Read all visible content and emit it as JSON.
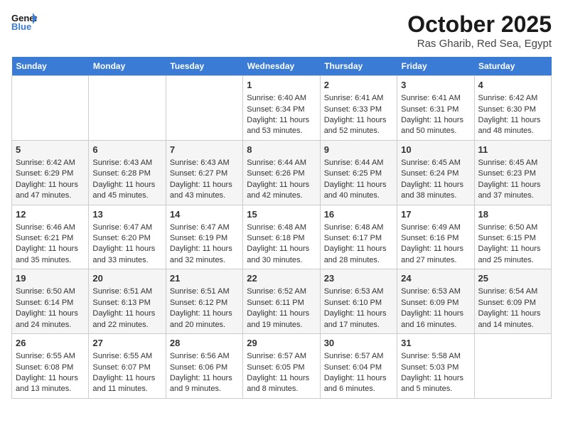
{
  "header": {
    "logo_text_general": "General",
    "logo_text_blue": "Blue",
    "month_title": "October 2025",
    "location": "Ras Gharib, Red Sea, Egypt"
  },
  "weekdays": [
    "Sunday",
    "Monday",
    "Tuesday",
    "Wednesday",
    "Thursday",
    "Friday",
    "Saturday"
  ],
  "weeks": [
    [
      {
        "day": "",
        "info": ""
      },
      {
        "day": "",
        "info": ""
      },
      {
        "day": "",
        "info": ""
      },
      {
        "day": "1",
        "info": "Sunrise: 6:40 AM\nSunset: 6:34 PM\nDaylight: 11 hours\nand 53 minutes."
      },
      {
        "day": "2",
        "info": "Sunrise: 6:41 AM\nSunset: 6:33 PM\nDaylight: 11 hours\nand 52 minutes."
      },
      {
        "day": "3",
        "info": "Sunrise: 6:41 AM\nSunset: 6:31 PM\nDaylight: 11 hours\nand 50 minutes."
      },
      {
        "day": "4",
        "info": "Sunrise: 6:42 AM\nSunset: 6:30 PM\nDaylight: 11 hours\nand 48 minutes."
      }
    ],
    [
      {
        "day": "5",
        "info": "Sunrise: 6:42 AM\nSunset: 6:29 PM\nDaylight: 11 hours\nand 47 minutes."
      },
      {
        "day": "6",
        "info": "Sunrise: 6:43 AM\nSunset: 6:28 PM\nDaylight: 11 hours\nand 45 minutes."
      },
      {
        "day": "7",
        "info": "Sunrise: 6:43 AM\nSunset: 6:27 PM\nDaylight: 11 hours\nand 43 minutes."
      },
      {
        "day": "8",
        "info": "Sunrise: 6:44 AM\nSunset: 6:26 PM\nDaylight: 11 hours\nand 42 minutes."
      },
      {
        "day": "9",
        "info": "Sunrise: 6:44 AM\nSunset: 6:25 PM\nDaylight: 11 hours\nand 40 minutes."
      },
      {
        "day": "10",
        "info": "Sunrise: 6:45 AM\nSunset: 6:24 PM\nDaylight: 11 hours\nand 38 minutes."
      },
      {
        "day": "11",
        "info": "Sunrise: 6:45 AM\nSunset: 6:23 PM\nDaylight: 11 hours\nand 37 minutes."
      }
    ],
    [
      {
        "day": "12",
        "info": "Sunrise: 6:46 AM\nSunset: 6:21 PM\nDaylight: 11 hours\nand 35 minutes."
      },
      {
        "day": "13",
        "info": "Sunrise: 6:47 AM\nSunset: 6:20 PM\nDaylight: 11 hours\nand 33 minutes."
      },
      {
        "day": "14",
        "info": "Sunrise: 6:47 AM\nSunset: 6:19 PM\nDaylight: 11 hours\nand 32 minutes."
      },
      {
        "day": "15",
        "info": "Sunrise: 6:48 AM\nSunset: 6:18 PM\nDaylight: 11 hours\nand 30 minutes."
      },
      {
        "day": "16",
        "info": "Sunrise: 6:48 AM\nSunset: 6:17 PM\nDaylight: 11 hours\nand 28 minutes."
      },
      {
        "day": "17",
        "info": "Sunrise: 6:49 AM\nSunset: 6:16 PM\nDaylight: 11 hours\nand 27 minutes."
      },
      {
        "day": "18",
        "info": "Sunrise: 6:50 AM\nSunset: 6:15 PM\nDaylight: 11 hours\nand 25 minutes."
      }
    ],
    [
      {
        "day": "19",
        "info": "Sunrise: 6:50 AM\nSunset: 6:14 PM\nDaylight: 11 hours\nand 24 minutes."
      },
      {
        "day": "20",
        "info": "Sunrise: 6:51 AM\nSunset: 6:13 PM\nDaylight: 11 hours\nand 22 minutes."
      },
      {
        "day": "21",
        "info": "Sunrise: 6:51 AM\nSunset: 6:12 PM\nDaylight: 11 hours\nand 20 minutes."
      },
      {
        "day": "22",
        "info": "Sunrise: 6:52 AM\nSunset: 6:11 PM\nDaylight: 11 hours\nand 19 minutes."
      },
      {
        "day": "23",
        "info": "Sunrise: 6:53 AM\nSunset: 6:10 PM\nDaylight: 11 hours\nand 17 minutes."
      },
      {
        "day": "24",
        "info": "Sunrise: 6:53 AM\nSunset: 6:09 PM\nDaylight: 11 hours\nand 16 minutes."
      },
      {
        "day": "25",
        "info": "Sunrise: 6:54 AM\nSunset: 6:09 PM\nDaylight: 11 hours\nand 14 minutes."
      }
    ],
    [
      {
        "day": "26",
        "info": "Sunrise: 6:55 AM\nSunset: 6:08 PM\nDaylight: 11 hours\nand 13 minutes."
      },
      {
        "day": "27",
        "info": "Sunrise: 6:55 AM\nSunset: 6:07 PM\nDaylight: 11 hours\nand 11 minutes."
      },
      {
        "day": "28",
        "info": "Sunrise: 6:56 AM\nSunset: 6:06 PM\nDaylight: 11 hours\nand 9 minutes."
      },
      {
        "day": "29",
        "info": "Sunrise: 6:57 AM\nSunset: 6:05 PM\nDaylight: 11 hours\nand 8 minutes."
      },
      {
        "day": "30",
        "info": "Sunrise: 6:57 AM\nSunset: 6:04 PM\nDaylight: 11 hours\nand 6 minutes."
      },
      {
        "day": "31",
        "info": "Sunrise: 5:58 AM\nSunset: 5:03 PM\nDaylight: 11 hours\nand 5 minutes."
      },
      {
        "day": "",
        "info": ""
      }
    ]
  ]
}
